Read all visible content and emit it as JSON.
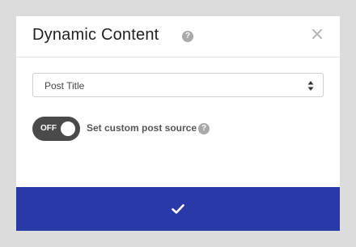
{
  "modal": {
    "title": "Dynamic Content",
    "help_glyph": "?",
    "close_icon": "close-icon"
  },
  "select": {
    "value": "Post Title",
    "icon": "select-arrows-icon"
  },
  "toggle": {
    "state_label": "OFF",
    "on": false,
    "text": "Set custom post source",
    "help_glyph": "?"
  },
  "footer": {
    "icon": "check-icon"
  },
  "colors": {
    "footer_bg": "#2a39a8",
    "toggle_bg": "#4a4a4a",
    "help_icon": "#a9a9a9",
    "page_bg": "#dcdcdc"
  }
}
